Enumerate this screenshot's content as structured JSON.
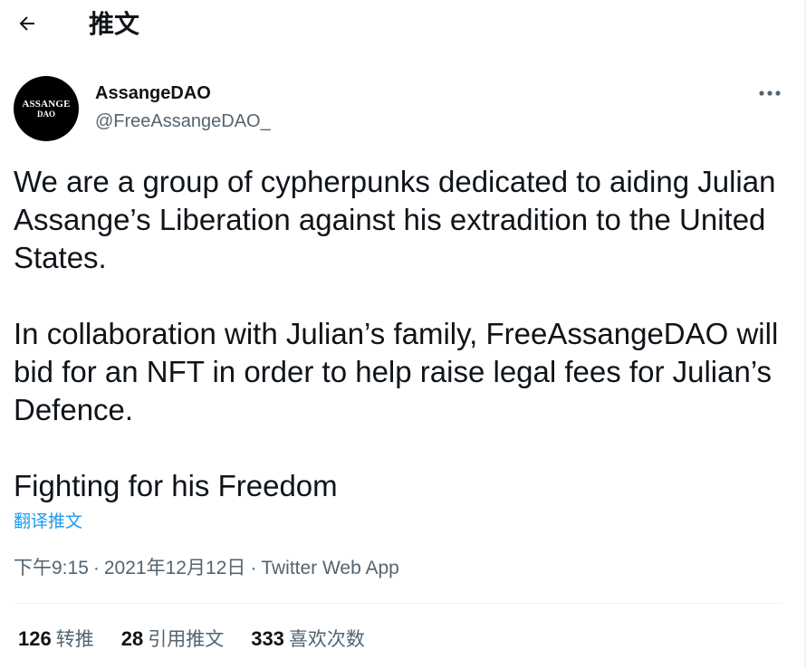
{
  "header": {
    "back_icon": "arrow-left-icon",
    "title": "推文"
  },
  "author": {
    "avatar_line1": "ASSANGE",
    "avatar_line2": "DAO",
    "display_name": "AssangeDAO",
    "handle": "@FreeAssangeDAO_",
    "more_icon": "more-horizontal-icon"
  },
  "tweet": {
    "paragraphs": [
      "We are a group of cypherpunks dedicated to aiding Julian Assange’s Liberation against his extradition to the United States.",
      "In collaboration with Julian’s family, FreeAssangeDAO will bid for an NFT in order to help raise legal fees for Julian’s Defence.",
      "Fighting for his Freedom"
    ],
    "translate_label": "翻译推文",
    "time": "下午9:15",
    "date": "2021年12月12日",
    "separator": "·",
    "source": "Twitter Web App"
  },
  "stats": {
    "retweets_count": "126",
    "retweets_label": "转推",
    "quotes_count": "28",
    "quotes_label": "引用推文",
    "likes_count": "333",
    "likes_label": "喜欢次数"
  },
  "colors": {
    "text": "#0f1419",
    "secondary": "#536471",
    "link": "#1d9bf0",
    "divider": "#eff3f4"
  }
}
